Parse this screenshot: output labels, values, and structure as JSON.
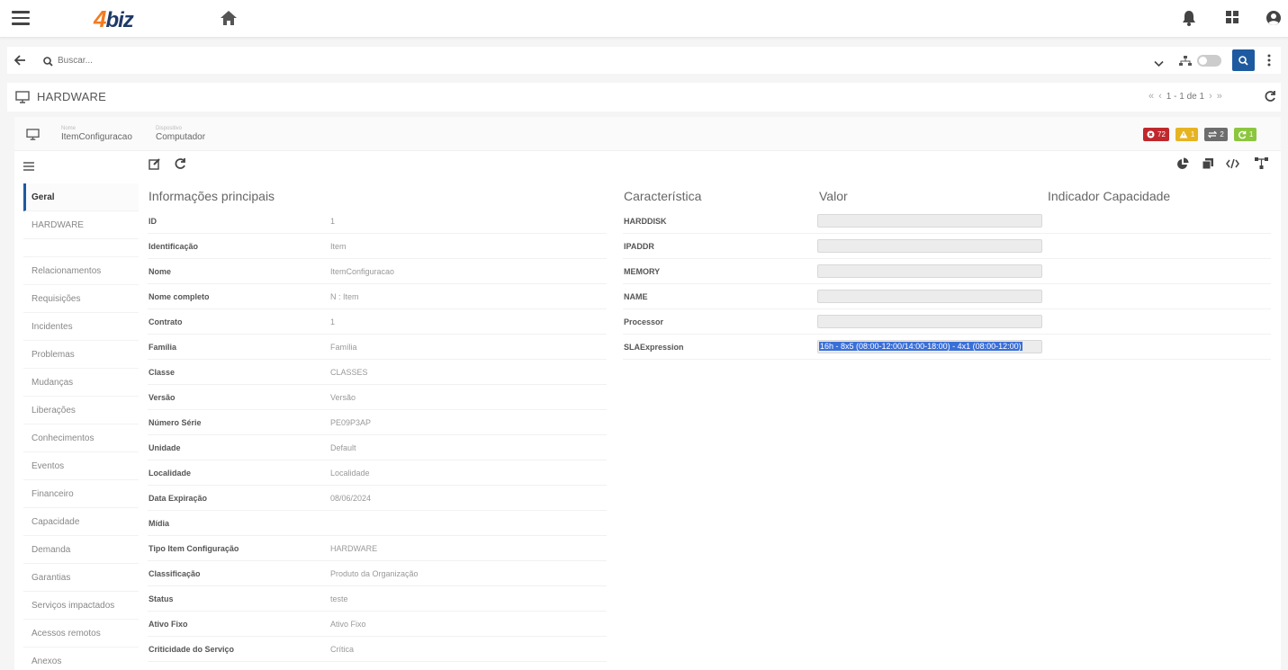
{
  "app": {
    "logo_prefix": "4",
    "logo_suffix": "biz",
    "colors": {
      "primary": "#1e5aa0",
      "logo_orange": "#f47b20",
      "logo_blue": "#1f3a68"
    }
  },
  "search": {
    "placeholder": "Buscar..."
  },
  "page": {
    "title": "HARDWARE",
    "pagination": "1 - 1 de 1"
  },
  "record": {
    "fields": [
      {
        "label": "Nome",
        "value": "ItemConfiguracao"
      },
      {
        "label": "Dispositivo",
        "value": "Computador"
      }
    ],
    "badges": [
      {
        "count": "72",
        "color": "#c0282d",
        "icon": "error-circle-icon"
      },
      {
        "count": "1",
        "color": "#e6b422",
        "icon": "warning-icon"
      },
      {
        "count": "2",
        "color": "#6d6d6d",
        "icon": "transfer-icon"
      },
      {
        "count": "1",
        "color": "#8cc63f",
        "icon": "sync-icon"
      }
    ]
  },
  "sidenav": {
    "primary": [
      "Geral",
      "HARDWARE"
    ],
    "secondary": [
      "Relacionamentos",
      "Requisições",
      "Incidentes",
      "Problemas",
      "Mudanças",
      "Liberações",
      "Conhecimentos",
      "Eventos",
      "Financeiro",
      "Capacidade",
      "Demanda",
      "Garantias",
      "Serviços impactados",
      "Acessos remotos",
      "Anexos"
    ]
  },
  "info": {
    "title": "Informações principais",
    "rows": [
      {
        "label": "ID",
        "value": "1"
      },
      {
        "label": "Identificação",
        "value": "Item"
      },
      {
        "label": "Nome",
        "value": "ItemConfiguracao"
      },
      {
        "label": "Nome completo",
        "value": "N : Item"
      },
      {
        "label": "Contrato",
        "value": "1"
      },
      {
        "label": "Família",
        "value": "Família"
      },
      {
        "label": "Classe",
        "value": "CLASSES"
      },
      {
        "label": "Versão",
        "value": "Versão"
      },
      {
        "label": "Número Série",
        "value": "PE09P3AP"
      },
      {
        "label": "Unidade",
        "value": "Default"
      },
      {
        "label": "Localidade",
        "value": "Localidade"
      },
      {
        "label": "Data Expiração",
        "value": "08/06/2024"
      },
      {
        "label": "Mídia",
        "value": ""
      },
      {
        "label": "Tipo Item Configuração",
        "value": "HARDWARE"
      },
      {
        "label": "Classificação",
        "value": "Produto da Organização"
      },
      {
        "label": "Status",
        "value": "teste"
      },
      {
        "label": "Ativo Fixo",
        "value": "Ativo Fixo"
      },
      {
        "label": "Criticidade do Serviço",
        "value": "Crítica"
      }
    ]
  },
  "characteristics": {
    "headers": {
      "name": "Característica",
      "value": "Valor",
      "capacity": "Indicador Capacidade"
    },
    "rows": [
      {
        "label": "HARDDISK",
        "value": ""
      },
      {
        "label": "IPADDR",
        "value": ""
      },
      {
        "label": "MEMORY",
        "value": ""
      },
      {
        "label": "NAME",
        "value": ""
      },
      {
        "label": "Processor",
        "value": ""
      },
      {
        "label": "SLAExpression",
        "value": "16h - 8x5 (08:00-12:00/14:00-18:00) - 4x1 (08:00-12:00)"
      }
    ]
  }
}
